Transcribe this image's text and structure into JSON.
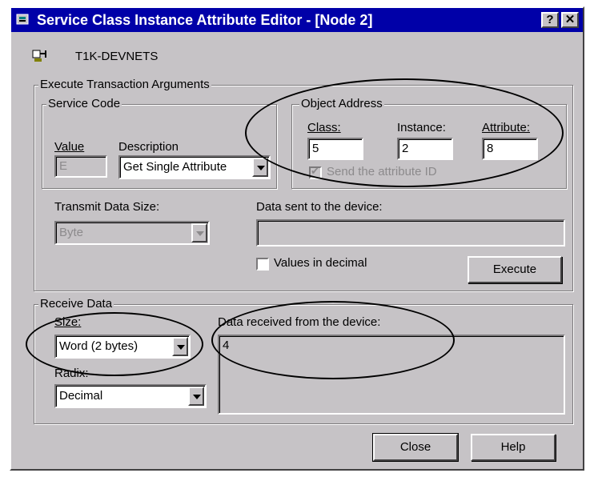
{
  "window": {
    "title": "Service Class Instance Attribute Editor - [Node 2]",
    "help_btn": "?",
    "close_btn": "✕"
  },
  "device": {
    "name": "T1K-DEVNETS"
  },
  "execute": {
    "group_label": "Execute Transaction Arguments",
    "service_code": {
      "group_label": "Service Code",
      "value_label": "Value",
      "value": "E",
      "description_label": "Description",
      "description_selected": "Get Single Attribute"
    },
    "object_address": {
      "group_label": "Object Address",
      "class_label": "Class:",
      "class_value": "5",
      "instance_label": "Instance:",
      "instance_value": "2",
      "attribute_label": "Attribute:",
      "attribute_value": "8",
      "send_attr_label": "Send the attribute ID",
      "send_attr_checked": true
    },
    "transmit_size_label": "Transmit Data Size:",
    "transmit_size_selected": "Byte",
    "data_sent_label": "Data sent to the device:",
    "data_sent_value": "",
    "values_decimal_label": "Values in decimal",
    "values_decimal_checked": false,
    "execute_button": "Execute"
  },
  "receive": {
    "group_label": "Receive Data",
    "size_label": "Size:",
    "size_selected": "Word (2 bytes)",
    "radix_label": "Radix:",
    "radix_selected": "Decimal",
    "data_received_label": "Data received from the device:",
    "data_received_value": "4"
  },
  "footer": {
    "close_button": "Close",
    "help_button": "Help"
  }
}
